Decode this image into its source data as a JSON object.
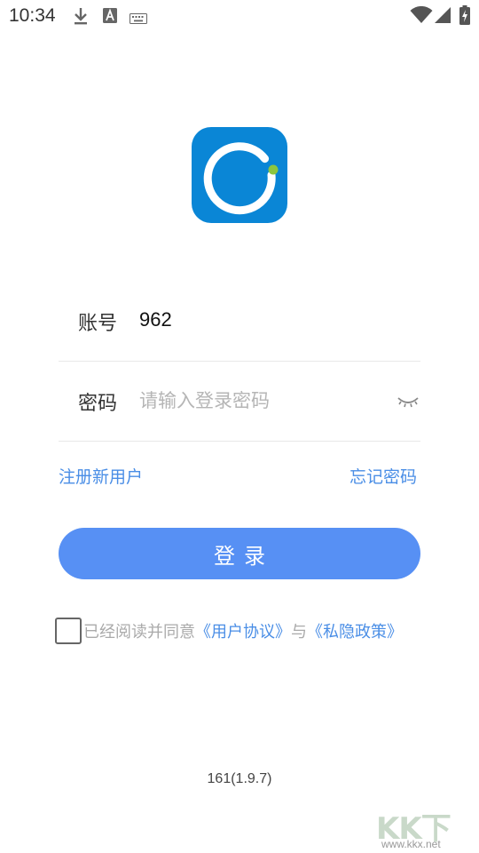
{
  "status_bar": {
    "time": "10:34",
    "icons": [
      "download-icon",
      "font-a-icon",
      "keyboard-icon",
      "wifi-icon",
      "signal-icon",
      "battery-charging-icon"
    ]
  },
  "logo": {
    "icon": "app-ring-logo-icon",
    "brand_color": "#0a86d6",
    "dot_color": "#8cc63f"
  },
  "account": {
    "label": "账号",
    "value": "962"
  },
  "password": {
    "label": "密码",
    "placeholder": "请输入登录密码",
    "toggle_icon": "eye-closed-icon"
  },
  "links": {
    "register": "注册新用户",
    "forgot": "忘记密码"
  },
  "login_button": {
    "label": "登录",
    "color": "#5790f4"
  },
  "agreement": {
    "checked": false,
    "prefix": "已经阅读并同意",
    "user_agreement": "《用户协议》",
    "connector": "与",
    "privacy_policy": "《私隐政策》"
  },
  "version": "161(1.9.7)",
  "watermark": {
    "main": "KK下载",
    "sub": "www.kkx.net"
  },
  "colors": {
    "link": "#4a8ee6",
    "accent": "#5790f4"
  }
}
